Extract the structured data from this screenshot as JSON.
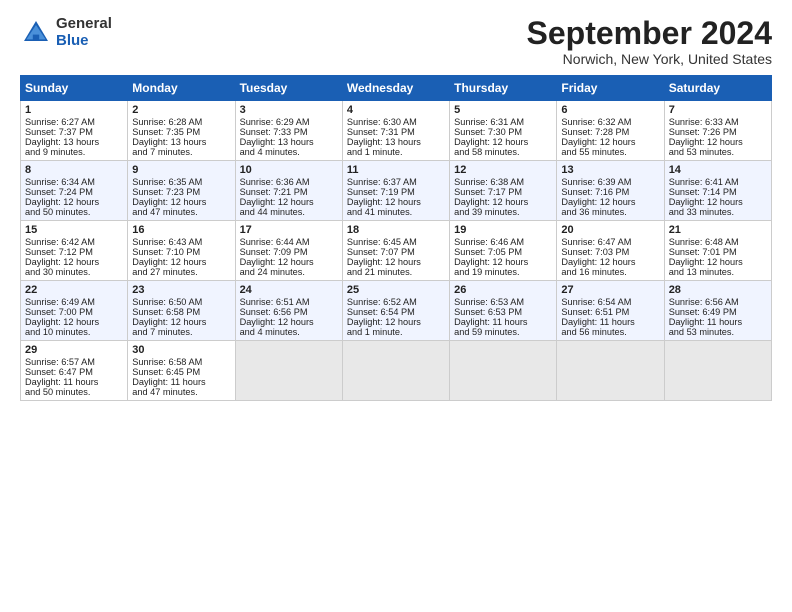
{
  "header": {
    "logo_general": "General",
    "logo_blue": "Blue",
    "month_title": "September 2024",
    "location": "Norwich, New York, United States"
  },
  "days_of_week": [
    "Sunday",
    "Monday",
    "Tuesday",
    "Wednesday",
    "Thursday",
    "Friday",
    "Saturday"
  ],
  "weeks": [
    [
      {
        "day": "1",
        "lines": [
          "Sunrise: 6:27 AM",
          "Sunset: 7:37 PM",
          "Daylight: 13 hours",
          "and 9 minutes."
        ]
      },
      {
        "day": "2",
        "lines": [
          "Sunrise: 6:28 AM",
          "Sunset: 7:35 PM",
          "Daylight: 13 hours",
          "and 7 minutes."
        ]
      },
      {
        "day": "3",
        "lines": [
          "Sunrise: 6:29 AM",
          "Sunset: 7:33 PM",
          "Daylight: 13 hours",
          "and 4 minutes."
        ]
      },
      {
        "day": "4",
        "lines": [
          "Sunrise: 6:30 AM",
          "Sunset: 7:31 PM",
          "Daylight: 13 hours",
          "and 1 minute."
        ]
      },
      {
        "day": "5",
        "lines": [
          "Sunrise: 6:31 AM",
          "Sunset: 7:30 PM",
          "Daylight: 12 hours",
          "and 58 minutes."
        ]
      },
      {
        "day": "6",
        "lines": [
          "Sunrise: 6:32 AM",
          "Sunset: 7:28 PM",
          "Daylight: 12 hours",
          "and 55 minutes."
        ]
      },
      {
        "day": "7",
        "lines": [
          "Sunrise: 6:33 AM",
          "Sunset: 7:26 PM",
          "Daylight: 12 hours",
          "and 53 minutes."
        ]
      }
    ],
    [
      {
        "day": "8",
        "lines": [
          "Sunrise: 6:34 AM",
          "Sunset: 7:24 PM",
          "Daylight: 12 hours",
          "and 50 minutes."
        ]
      },
      {
        "day": "9",
        "lines": [
          "Sunrise: 6:35 AM",
          "Sunset: 7:23 PM",
          "Daylight: 12 hours",
          "and 47 minutes."
        ]
      },
      {
        "day": "10",
        "lines": [
          "Sunrise: 6:36 AM",
          "Sunset: 7:21 PM",
          "Daylight: 12 hours",
          "and 44 minutes."
        ]
      },
      {
        "day": "11",
        "lines": [
          "Sunrise: 6:37 AM",
          "Sunset: 7:19 PM",
          "Daylight: 12 hours",
          "and 41 minutes."
        ]
      },
      {
        "day": "12",
        "lines": [
          "Sunrise: 6:38 AM",
          "Sunset: 7:17 PM",
          "Daylight: 12 hours",
          "and 39 minutes."
        ]
      },
      {
        "day": "13",
        "lines": [
          "Sunrise: 6:39 AM",
          "Sunset: 7:16 PM",
          "Daylight: 12 hours",
          "and 36 minutes."
        ]
      },
      {
        "day": "14",
        "lines": [
          "Sunrise: 6:41 AM",
          "Sunset: 7:14 PM",
          "Daylight: 12 hours",
          "and 33 minutes."
        ]
      }
    ],
    [
      {
        "day": "15",
        "lines": [
          "Sunrise: 6:42 AM",
          "Sunset: 7:12 PM",
          "Daylight: 12 hours",
          "and 30 minutes."
        ]
      },
      {
        "day": "16",
        "lines": [
          "Sunrise: 6:43 AM",
          "Sunset: 7:10 PM",
          "Daylight: 12 hours",
          "and 27 minutes."
        ]
      },
      {
        "day": "17",
        "lines": [
          "Sunrise: 6:44 AM",
          "Sunset: 7:09 PM",
          "Daylight: 12 hours",
          "and 24 minutes."
        ]
      },
      {
        "day": "18",
        "lines": [
          "Sunrise: 6:45 AM",
          "Sunset: 7:07 PM",
          "Daylight: 12 hours",
          "and 21 minutes."
        ]
      },
      {
        "day": "19",
        "lines": [
          "Sunrise: 6:46 AM",
          "Sunset: 7:05 PM",
          "Daylight: 12 hours",
          "and 19 minutes."
        ]
      },
      {
        "day": "20",
        "lines": [
          "Sunrise: 6:47 AM",
          "Sunset: 7:03 PM",
          "Daylight: 12 hours",
          "and 16 minutes."
        ]
      },
      {
        "day": "21",
        "lines": [
          "Sunrise: 6:48 AM",
          "Sunset: 7:01 PM",
          "Daylight: 12 hours",
          "and 13 minutes."
        ]
      }
    ],
    [
      {
        "day": "22",
        "lines": [
          "Sunrise: 6:49 AM",
          "Sunset: 7:00 PM",
          "Daylight: 12 hours",
          "and 10 minutes."
        ]
      },
      {
        "day": "23",
        "lines": [
          "Sunrise: 6:50 AM",
          "Sunset: 6:58 PM",
          "Daylight: 12 hours",
          "and 7 minutes."
        ]
      },
      {
        "day": "24",
        "lines": [
          "Sunrise: 6:51 AM",
          "Sunset: 6:56 PM",
          "Daylight: 12 hours",
          "and 4 minutes."
        ]
      },
      {
        "day": "25",
        "lines": [
          "Sunrise: 6:52 AM",
          "Sunset: 6:54 PM",
          "Daylight: 12 hours",
          "and 1 minute."
        ]
      },
      {
        "day": "26",
        "lines": [
          "Sunrise: 6:53 AM",
          "Sunset: 6:53 PM",
          "Daylight: 11 hours",
          "and 59 minutes."
        ]
      },
      {
        "day": "27",
        "lines": [
          "Sunrise: 6:54 AM",
          "Sunset: 6:51 PM",
          "Daylight: 11 hours",
          "and 56 minutes."
        ]
      },
      {
        "day": "28",
        "lines": [
          "Sunrise: 6:56 AM",
          "Sunset: 6:49 PM",
          "Daylight: 11 hours",
          "and 53 minutes."
        ]
      }
    ],
    [
      {
        "day": "29",
        "lines": [
          "Sunrise: 6:57 AM",
          "Sunset: 6:47 PM",
          "Daylight: 11 hours",
          "and 50 minutes."
        ]
      },
      {
        "day": "30",
        "lines": [
          "Sunrise: 6:58 AM",
          "Sunset: 6:45 PM",
          "Daylight: 11 hours",
          "and 47 minutes."
        ]
      },
      {
        "day": "",
        "lines": []
      },
      {
        "day": "",
        "lines": []
      },
      {
        "day": "",
        "lines": []
      },
      {
        "day": "",
        "lines": []
      },
      {
        "day": "",
        "lines": []
      }
    ]
  ]
}
